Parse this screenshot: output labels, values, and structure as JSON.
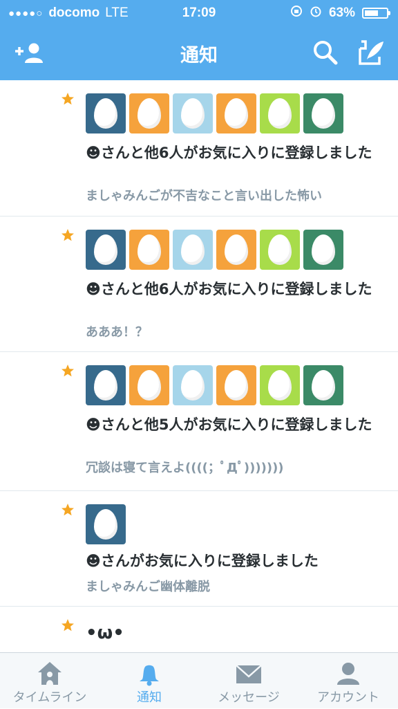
{
  "status_bar": {
    "signal": "●●●●○",
    "carrier": "docomo",
    "network": "LTE",
    "time": "17:09",
    "battery": "63%",
    "battery_level": 0.63
  },
  "navbar": {
    "title": "通知",
    "add_user_icon": "add-user-icon",
    "search_icon": "search-icon",
    "compose_icon": "compose-icon"
  },
  "colors": {
    "brand": "#55acee",
    "star": "#f5a623",
    "egg_palette": [
      "#376a8c",
      "#f5a23c",
      "#a6d5ea",
      "#f5a23c",
      "#a8dc4a",
      "#3b8a67"
    ]
  },
  "notifications": [
    {
      "text": "☻さんと他6人がお気に入りに登録しました",
      "tweet": "ましゃみんごが不吉なこと言い出した怖い",
      "avatar_count": 6
    },
    {
      "text": "☻さんと他6人がお気に入りに登録しました",
      "tweet": "あああ！？",
      "avatar_count": 6
    },
    {
      "text": "☻さんと他5人がお気に入りに登録しました",
      "tweet": "冗談は寝て言えよ((((；ﾟДﾟ)))))))",
      "avatar_count": 6
    },
    {
      "text": "☻さんがお気に入りに登録しました",
      "tweet": "ましゃみんご幽体離脱",
      "avatar_count": 1
    },
    {
      "text": "•ω•",
      "tweet": "",
      "avatar_count": 0
    }
  ],
  "tabbar": [
    {
      "label": "タイムライン",
      "icon": "home-icon",
      "active": false
    },
    {
      "label": "通知",
      "icon": "bell-icon",
      "active": true
    },
    {
      "label": "メッセージ",
      "icon": "envelope-icon",
      "active": false
    },
    {
      "label": "アカウント",
      "icon": "person-icon",
      "active": false
    }
  ]
}
